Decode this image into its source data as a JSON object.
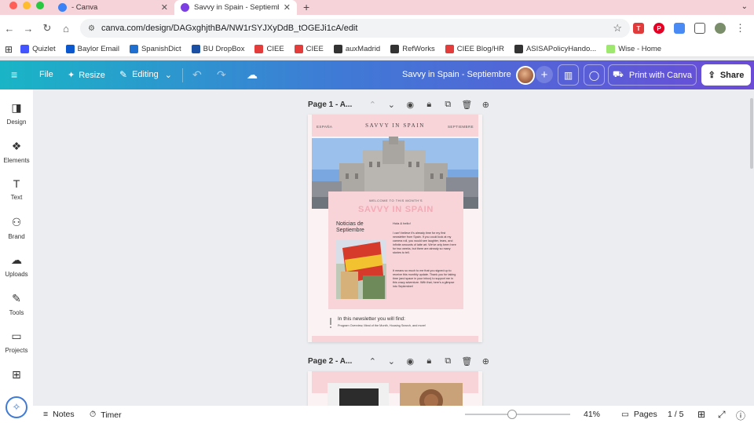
{
  "browser": {
    "tabs": [
      {
        "label": "- Canva",
        "active": false
      },
      {
        "label": "Savvy in Spain - Septiembre",
        "active": true
      }
    ],
    "url": "canva.com/design/DAGxghjthBA/NW1rSYJXyDdB_tOGEJi1cA/edit",
    "bookmarks": [
      {
        "label": "Quizlet",
        "color": "#4255ff"
      },
      {
        "label": "Baylor Email",
        "color": "#0b57d0"
      },
      {
        "label": "SpanishDict",
        "color": "#1f6fd1"
      },
      {
        "label": "BU DropBox",
        "color": "#1a4fa3"
      },
      {
        "label": "CIEE",
        "color": "#e43b3b"
      },
      {
        "label": "CIEE",
        "color": "#e43b3b"
      },
      {
        "label": "auxMadrid",
        "color": "#333333"
      },
      {
        "label": "RefWorks",
        "color": "#333333"
      },
      {
        "label": "CIEE Blog/HR",
        "color": "#e43b3b"
      },
      {
        "label": "ASISAPolicyHando...",
        "color": "#333333"
      },
      {
        "label": "Wise - Home",
        "color": "#9fe870"
      }
    ]
  },
  "toolbar": {
    "file": "File",
    "resize": "Resize",
    "editing": "Editing",
    "doc_title": "Savvy in Spain - Septiembre",
    "print": "Print with Canva",
    "share": "Share"
  },
  "sidebar": [
    {
      "label": "Design",
      "icon": "design-icon"
    },
    {
      "label": "Elements",
      "icon": "elements-icon"
    },
    {
      "label": "Text",
      "icon": "text-icon"
    },
    {
      "label": "Brand",
      "icon": "brand-icon"
    },
    {
      "label": "Uploads",
      "icon": "uploads-icon"
    },
    {
      "label": "Tools",
      "icon": "tools-icon"
    },
    {
      "label": "Projects",
      "icon": "projects-icon"
    },
    {
      "label": "",
      "icon": "apps-icon"
    }
  ],
  "pages": [
    {
      "label": "Page 1 - A..."
    },
    {
      "label": "Page 2 - A..."
    }
  ],
  "newsletter": {
    "espana": "ESPAÑA",
    "masthead": "SAVVY IN SPAIN",
    "month": "SEPTIEMBRE",
    "welcome": "WELCOME TO THIS MONTH'S",
    "title": "SAVVY IN SPAIN",
    "noticias": "Noticias de Septiembre",
    "greeting": "Hola & hello!",
    "para1": "I can't believe it's already time for my first newsletter from Spain. If you could look at my camera roll, you would see laughter, tears, and infinite amounts of latte art. We've only been here for two weeks, but there are already so many stories to tell.",
    "para2": "It means so much to me that you signed up to receive this monthly update. Thank you for taking time (and space in your inbox) to support me in this crazy adventure. With that, here's a glimpse into September!",
    "in_this": "In this newsletter you will find:",
    "contents": "Program Overview, Meal of the Month, Housing Search, and more!"
  },
  "status": {
    "notes": "Notes",
    "timer": "Timer",
    "zoom": "41%",
    "pages": "Pages",
    "page_count": "1 / 5",
    "zoom_level": 0.45
  },
  "colors": {
    "accent_pink": "#f4a9b4",
    "page_pink": "#f8d4d9",
    "brand_purple": "#6b4bd8",
    "brand_teal": "#19b5c6"
  }
}
